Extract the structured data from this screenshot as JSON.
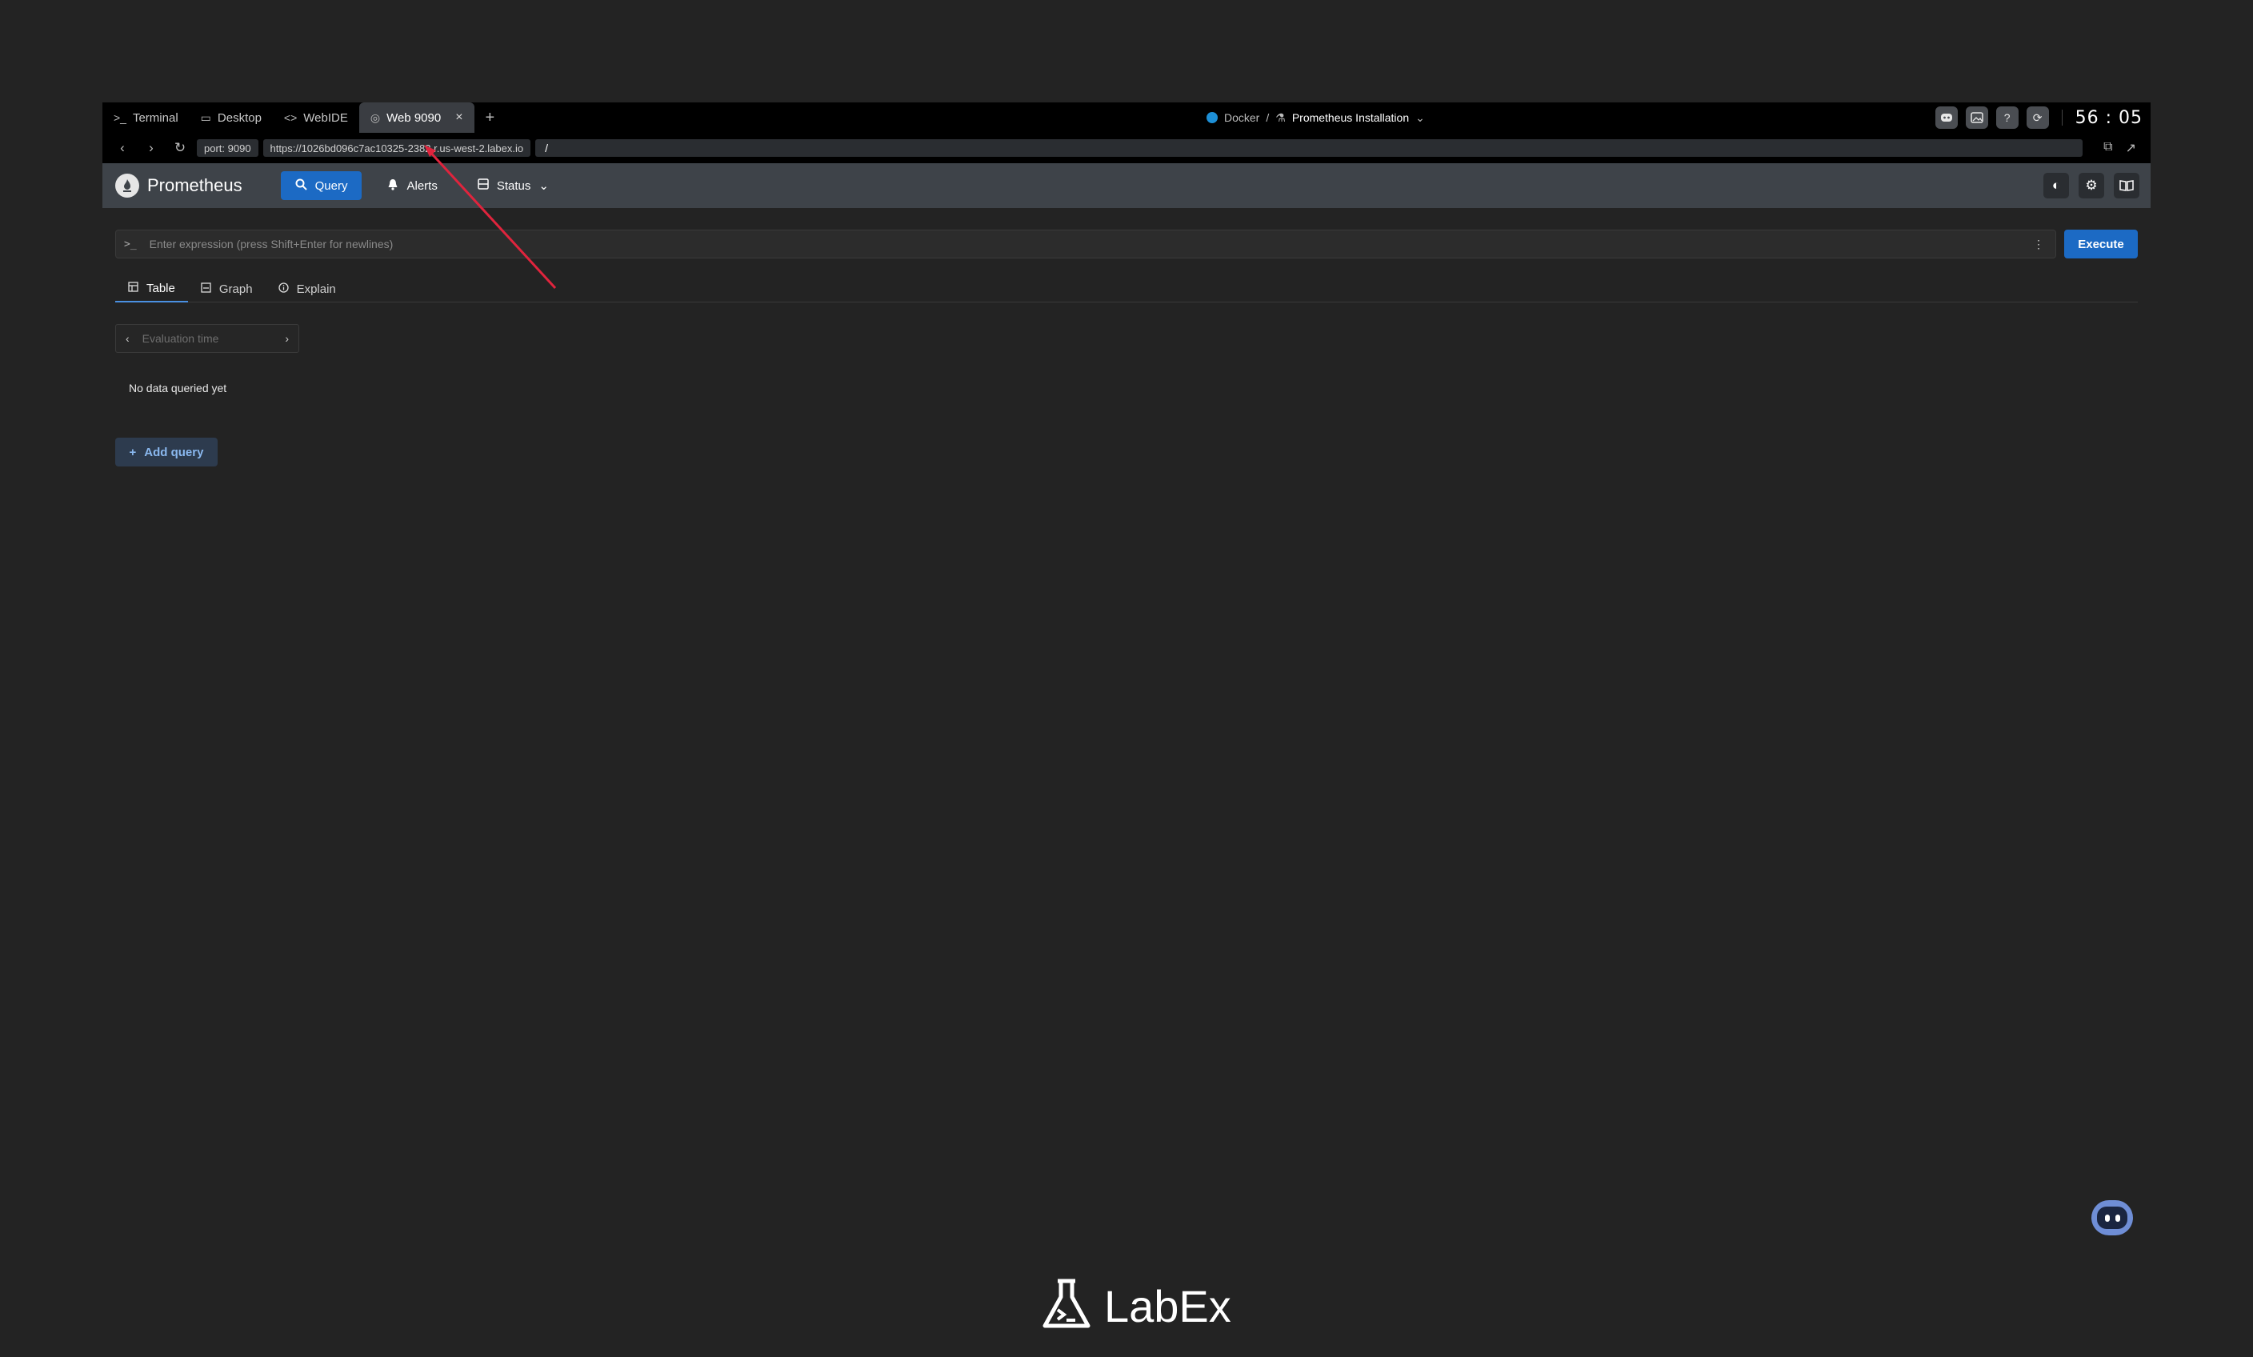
{
  "workspace": {
    "tabs": [
      {
        "icon": ">_",
        "label": "Terminal"
      },
      {
        "icon": "▭",
        "label": "Desktop"
      },
      {
        "icon": "<>",
        "label": "WebIDE"
      },
      {
        "icon": "◎",
        "label": "Web 9090"
      }
    ],
    "add_tab": "+",
    "breadcrumb": {
      "root": "Docker",
      "separator": "/",
      "current": "Prometheus Installation"
    },
    "timer": "56 : 05"
  },
  "urlbar": {
    "port": "port: 9090",
    "host": "https://1026bd096c7ac10325-2382.r.us-west-2.labex.io",
    "path": "/"
  },
  "app": {
    "title": "Prometheus",
    "nav": {
      "query": "Query",
      "alerts": "Alerts",
      "status": "Status"
    },
    "expression_placeholder": "Enter expression (press Shift+Enter for newlines)",
    "execute": "Execute",
    "view_tabs": {
      "table": "Table",
      "graph": "Graph",
      "explain": "Explain"
    },
    "evaluation_time_placeholder": "Evaluation time",
    "no_data": "No data queried yet",
    "add_query": "Add query"
  },
  "footer": {
    "brand": "LabEx"
  },
  "colors": {
    "accent": "#1c6ac4",
    "annotation_arrow": "#e0243d"
  }
}
